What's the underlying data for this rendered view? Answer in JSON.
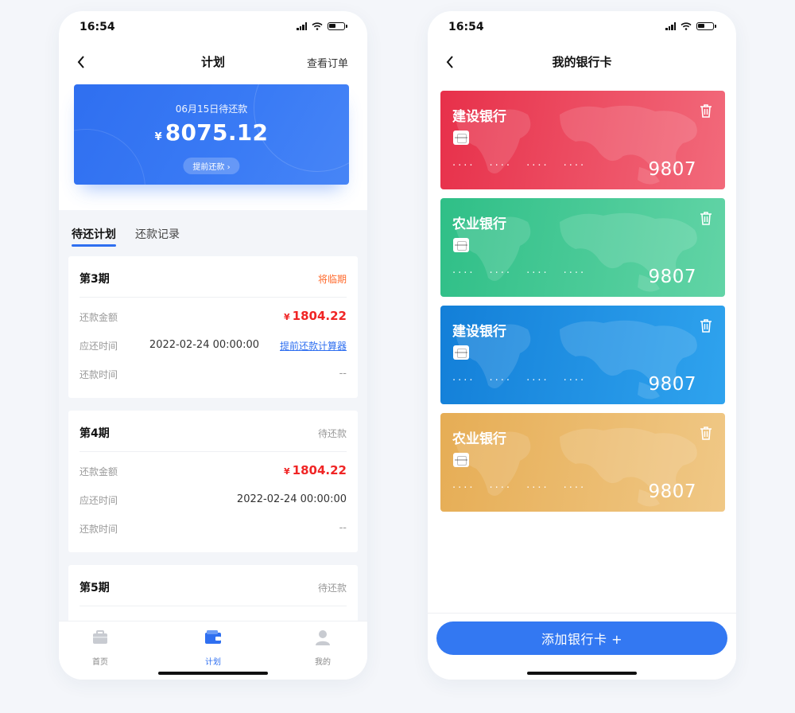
{
  "colors": {
    "accent": "#2f6ff0",
    "warning": "#ff6a2c",
    "amount": "#f02525",
    "card_red": "#e8384f",
    "card_green": "#3fc58f",
    "card_blue": "#1e8ee0",
    "card_gold": "#e9b562"
  },
  "left": {
    "status_time": "16:54",
    "nav": {
      "title": "计划",
      "action": "查看订单",
      "back_icon": "chevron-left-icon"
    },
    "hero": {
      "date_label": "06月15日待还款",
      "currency": "¥",
      "amount": "8075.12",
      "button_label": "提前还款 ›"
    },
    "tabs": [
      {
        "label": "待还计划",
        "active": true
      },
      {
        "label": "还款记录",
        "active": false
      }
    ],
    "plans": [
      {
        "title": "第3期",
        "status": "将临期",
        "amount_label": "还款金额",
        "currency": "¥",
        "amount": "1804.22",
        "due_label": "应还时间",
        "due_value": "2022-02-24 00:00:00",
        "calc_link": "提前还款计算器",
        "paid_label": "还款时间",
        "paid_value": "--"
      },
      {
        "title": "第4期",
        "status": "待还款",
        "amount_label": "还款金额",
        "currency": "¥",
        "amount": "1804.22",
        "due_label": "应还时间",
        "due_value": "2022-02-24 00:00:00",
        "paid_label": "还款时间",
        "paid_value": "--"
      },
      {
        "title": "第5期",
        "status": "待还款"
      }
    ],
    "tabbar": [
      {
        "label": "首页",
        "icon": "briefcase-icon"
      },
      {
        "label": "计划",
        "icon": "wallet-icon"
      },
      {
        "label": "我的",
        "icon": "user-icon"
      }
    ]
  },
  "right": {
    "status_time": "16:54",
    "nav": {
      "title": "我的银行卡",
      "back_icon": "chevron-left-icon"
    },
    "cards": [
      {
        "bank": "建设银行",
        "masked": [
          "····",
          "····",
          "····",
          "····"
        ],
        "last4": "9807",
        "color": "red"
      },
      {
        "bank": "农业银行",
        "masked": [
          "····",
          "····",
          "····",
          "····"
        ],
        "last4": "9807",
        "color": "green"
      },
      {
        "bank": "建设银行",
        "masked": [
          "····",
          "····",
          "····",
          "····"
        ],
        "last4": "9807",
        "color": "blue"
      },
      {
        "bank": "农业银行",
        "masked": [
          "····",
          "····",
          "····",
          "····"
        ],
        "last4": "9807",
        "color": "gold"
      }
    ],
    "add_button": "添加银行卡 +"
  }
}
